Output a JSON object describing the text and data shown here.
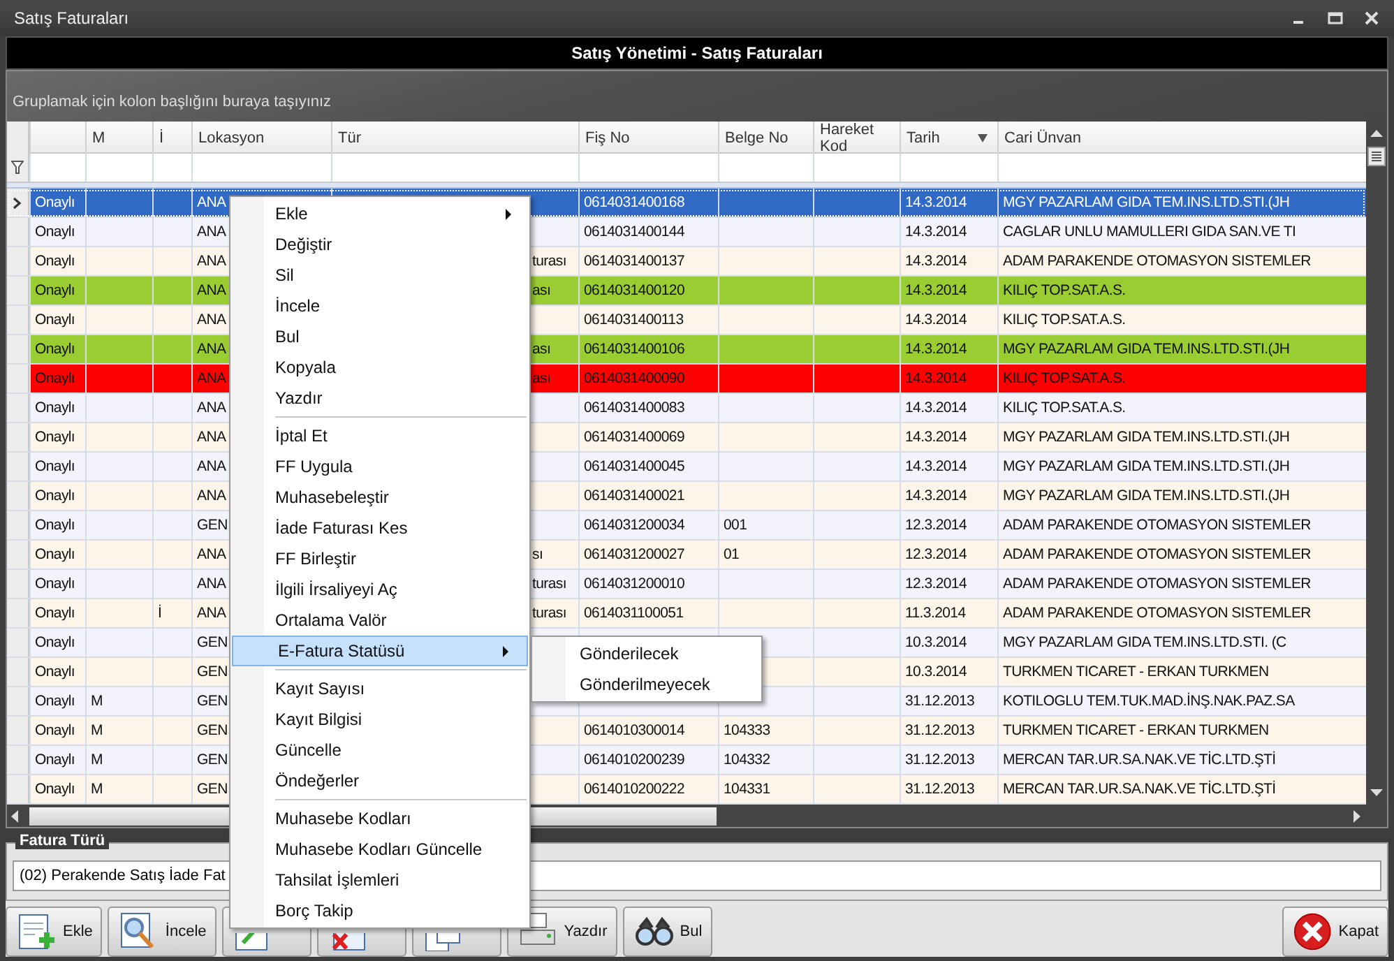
{
  "window": {
    "title": "Satış Faturaları"
  },
  "header": {
    "title": "Satış Yönetimi - Satış Faturaları"
  },
  "group_panel": {
    "hint": "Gruplamak için kolon başlığını buraya taşıyınız"
  },
  "table": {
    "columns": [
      {
        "sort_descending": false
      },
      {
        "label": "M",
        "sort_descending": false
      },
      {
        "label": "İ",
        "sort_descending": false
      },
      {
        "label": "Lokasyon",
        "sort_descending": false
      },
      {
        "label": "Tür",
        "sort_descending": false
      },
      {
        "label": "Fiş No",
        "sort_descending": false
      },
      {
        "label": "Belge No",
        "sort_descending": false
      },
      {
        "label": "Hareket Kod",
        "sort_descending": false
      },
      {
        "label": "Tarih",
        "sort_descending": true
      },
      {
        "label": "Cari Ünvan",
        "sort_descending": false
      }
    ],
    "rows": [
      {
        "selected": true,
        "column_1": "Onaylı",
        "lokasyon": "ANA",
        "fis_no": "0614031400168",
        "tarih": "14.3.2014",
        "cari_unvan": "MGY PAZARLAM GIDA TEM.INS.LTD.STI.(JH"
      },
      {
        "selected": false,
        "column_1": "Onaylı",
        "lokasyon": "ANA",
        "fis_no": "0614031400144",
        "tarih": "14.3.2014",
        "cari_unvan": "CAGLAR UNLU MAMULLERI GIDA SAN.VE TI"
      },
      {
        "selected": false,
        "column_1": "Onaylı",
        "lokasyon": "ANA",
        "tur": "turası",
        "fis_no": "0614031400137",
        "tarih": "14.3.2014",
        "cari_unvan": "ADAM PARAKENDE OTOMASYON SISTEMLER"
      },
      {
        "selected": false,
        "color": "#9acd32",
        "column_1": "Onaylı",
        "lokasyon": "ANA",
        "tur": "ası",
        "fis_no": "0614031400120",
        "tarih": "14.3.2014",
        "cari_unvan": "KILIÇ TOP.SAT.A.S."
      },
      {
        "selected": false,
        "column_1": "Onaylı",
        "lokasyon": "ANA",
        "fis_no": "0614031400113",
        "tarih": "14.3.2014",
        "cari_unvan": "KILIÇ TOP.SAT.A.S."
      },
      {
        "selected": false,
        "color": "#9acd32",
        "column_1": "Onaylı",
        "lokasyon": "ANA",
        "tur": "ası",
        "fis_no": "0614031400106",
        "tarih": "14.3.2014",
        "cari_unvan": "MGY PAZARLAM GIDA TEM.INS.LTD.STI.(JH"
      },
      {
        "selected": false,
        "color": "#ff0000",
        "column_1": "Onaylı",
        "lokasyon": "ANA",
        "tur": "ası",
        "fis_no": "0614031400090",
        "tarih": "14.3.2014",
        "cari_unvan": "KILIÇ TOP.SAT.A.S."
      },
      {
        "selected": false,
        "column_1": "Onaylı",
        "lokasyon": "ANA",
        "fis_no": "0614031400083",
        "tarih": "14.3.2014",
        "cari_unvan": "KILIÇ TOP.SAT.A.S."
      },
      {
        "selected": false,
        "column_1": "Onaylı",
        "lokasyon": "ANA",
        "fis_no": "0614031400069",
        "tarih": "14.3.2014",
        "cari_unvan": "MGY PAZARLAM GIDA TEM.INS.LTD.STI.(JH"
      },
      {
        "selected": false,
        "column_1": "Onaylı",
        "lokasyon": "ANA",
        "fis_no": "0614031400045",
        "tarih": "14.3.2014",
        "cari_unvan": "MGY PAZARLAM GIDA TEM.INS.LTD.STI.(JH"
      },
      {
        "selected": false,
        "column_1": "Onaylı",
        "lokasyon": "ANA",
        "fis_no": "0614031400021",
        "tarih": "14.3.2014",
        "cari_unvan": "MGY PAZARLAM GIDA TEM.INS.LTD.STI.(JH"
      },
      {
        "selected": false,
        "column_1": "Onaylı",
        "lokasyon": "GEN",
        "fis_no": "0614031200034",
        "belge_no": "001",
        "tarih": "12.3.2014",
        "cari_unvan": "ADAM PARAKENDE OTOMASYON SISTEMLER"
      },
      {
        "selected": false,
        "column_1": "Onaylı",
        "lokasyon": "ANA",
        "tur": "sı",
        "fis_no": "0614031200027",
        "belge_no": "01",
        "tarih": "12.3.2014",
        "cari_unvan": "ADAM PARAKENDE OTOMASYON SISTEMLER"
      },
      {
        "selected": false,
        "column_1": "Onaylı",
        "lokasyon": "ANA",
        "tur": "turası",
        "fis_no": "0614031200010",
        "tarih": "12.3.2014",
        "cari_unvan": "ADAM PARAKENDE OTOMASYON SISTEMLER"
      },
      {
        "selected": false,
        "column_1": "Onaylı",
        "i": "İ",
        "lokasyon": "ANA",
        "tur": "turası",
        "fis_no": "0614031100051",
        "tarih": "11.3.2014",
        "cari_unvan": "ADAM PARAKENDE OTOMASYON SISTEMLER"
      },
      {
        "selected": false,
        "column_1": "Onaylı",
        "lokasyon": "GEN",
        "tarih": "10.3.2014",
        "cari_unvan": "MGY PAZARLAM GIDA TEM.INS.LTD.STI. (C"
      },
      {
        "selected": false,
        "column_1": "Onaylı",
        "lokasyon": "GEN",
        "tarih": "10.3.2014",
        "cari_unvan": "TURKMEN TICARET - ERKAN TURKMEN"
      },
      {
        "selected": false,
        "column_1": "Onaylı",
        "m": "M",
        "lokasyon": "GEN",
        "tarih": "31.12.2013",
        "cari_unvan": "KOTILOGLU TEM.TUK.MAD.İNŞ.NAK.PAZ.SA"
      },
      {
        "selected": false,
        "column_1": "Onaylı",
        "m": "M",
        "lokasyon": "GEN",
        "fis_no": "0614010300014",
        "belge_no": "104333",
        "tarih": "31.12.2013",
        "cari_unvan": "TURKMEN TICARET - ERKAN TURKMEN"
      },
      {
        "selected": false,
        "column_1": "Onaylı",
        "m": "M",
        "lokasyon": "GEN",
        "fis_no": "0614010200239",
        "belge_no": "104332",
        "tarih": "31.12.2013",
        "cari_unvan": "MERCAN TAR.UR.SA.NAK.VE TİC.LTD.ŞTİ"
      },
      {
        "selected": false,
        "column_1": "Onaylı",
        "m": "M",
        "lokasyon": "GEN",
        "fis_no": "0614010200222",
        "belge_no": "104331",
        "tarih": "31.12.2013",
        "cari_unvan": "MERCAN TAR.UR.SA.NAK.VE TİC.LTD.ŞTİ"
      }
    ]
  },
  "invoice_type": {
    "label": "Fatura Türü",
    "value": "(02) Perakende Satış İade Fat"
  },
  "buttons": [
    {
      "kind": "add",
      "label": "Ekle"
    },
    {
      "kind": "inspect",
      "label": "İncele"
    },
    {
      "kind": "edit"
    },
    {
      "kind": "delete"
    },
    {
      "kind": "copy"
    },
    {
      "kind": "print",
      "label": "Yazdır"
    },
    {
      "kind": "find",
      "label": "Bul"
    }
  ],
  "close_button": {
    "label": "Kapat"
  },
  "context_menu": {
    "items": [
      {
        "kind": "item",
        "label": "Ekle",
        "submenu": true,
        "selected": false
      },
      {
        "kind": "item",
        "label": "Değiştir",
        "submenu": false,
        "selected": false
      },
      {
        "kind": "item",
        "label": "Sil",
        "submenu": false,
        "selected": false
      },
      {
        "kind": "item",
        "label": "İncele",
        "submenu": false,
        "selected": false
      },
      {
        "kind": "item",
        "label": "Bul",
        "submenu": false,
        "selected": false
      },
      {
        "kind": "item",
        "label": "Kopyala",
        "submenu": false,
        "selected": false
      },
      {
        "kind": "item",
        "label": "Yazdır",
        "submenu": false,
        "selected": false
      },
      {
        "kind": "separator"
      },
      {
        "kind": "item",
        "label": "İptal Et",
        "submenu": false,
        "selected": false
      },
      {
        "kind": "item",
        "label": "FF Uygula",
        "submenu": false,
        "selected": false
      },
      {
        "kind": "item",
        "label": "Muhasebeleştir",
        "submenu": false,
        "selected": false
      },
      {
        "kind": "item",
        "label": "İade Faturası Kes",
        "submenu": false,
        "selected": false
      },
      {
        "kind": "item",
        "label": "FF Birleştir",
        "submenu": false,
        "selected": false
      },
      {
        "kind": "item",
        "label": "İlgili İrsaliyeyi Aç",
        "submenu": false,
        "selected": false
      },
      {
        "kind": "item",
        "label": "Ortalama Valör",
        "submenu": false,
        "selected": false
      },
      {
        "kind": "item",
        "label": "E-Fatura Statüsü",
        "submenu": true,
        "selected": true
      },
      {
        "kind": "separator"
      },
      {
        "kind": "item",
        "label": "Kayıt Sayısı",
        "submenu": false,
        "selected": false
      },
      {
        "kind": "item",
        "label": "Kayıt Bilgisi",
        "submenu": false,
        "selected": false
      },
      {
        "kind": "item",
        "label": "Güncelle",
        "submenu": false,
        "selected": false
      },
      {
        "kind": "item",
        "label": "Öndeğerler",
        "submenu": false,
        "selected": false
      },
      {
        "kind": "separator"
      },
      {
        "kind": "item",
        "label": "Muhasebe Kodları",
        "submenu": false,
        "selected": false
      },
      {
        "kind": "item",
        "label": "Muhasebe Kodları Güncelle",
        "submenu": false,
        "selected": false
      },
      {
        "kind": "item",
        "label": "Tahsilat İşlemleri",
        "submenu": false,
        "selected": false
      },
      {
        "kind": "item",
        "label": "Borç Takip",
        "submenu": false,
        "selected": false
      }
    ],
    "submenu": {
      "items": [
        {
          "label": "Gönderilecek"
        },
        {
          "label": "Gönderilmeyecek"
        }
      ]
    }
  }
}
